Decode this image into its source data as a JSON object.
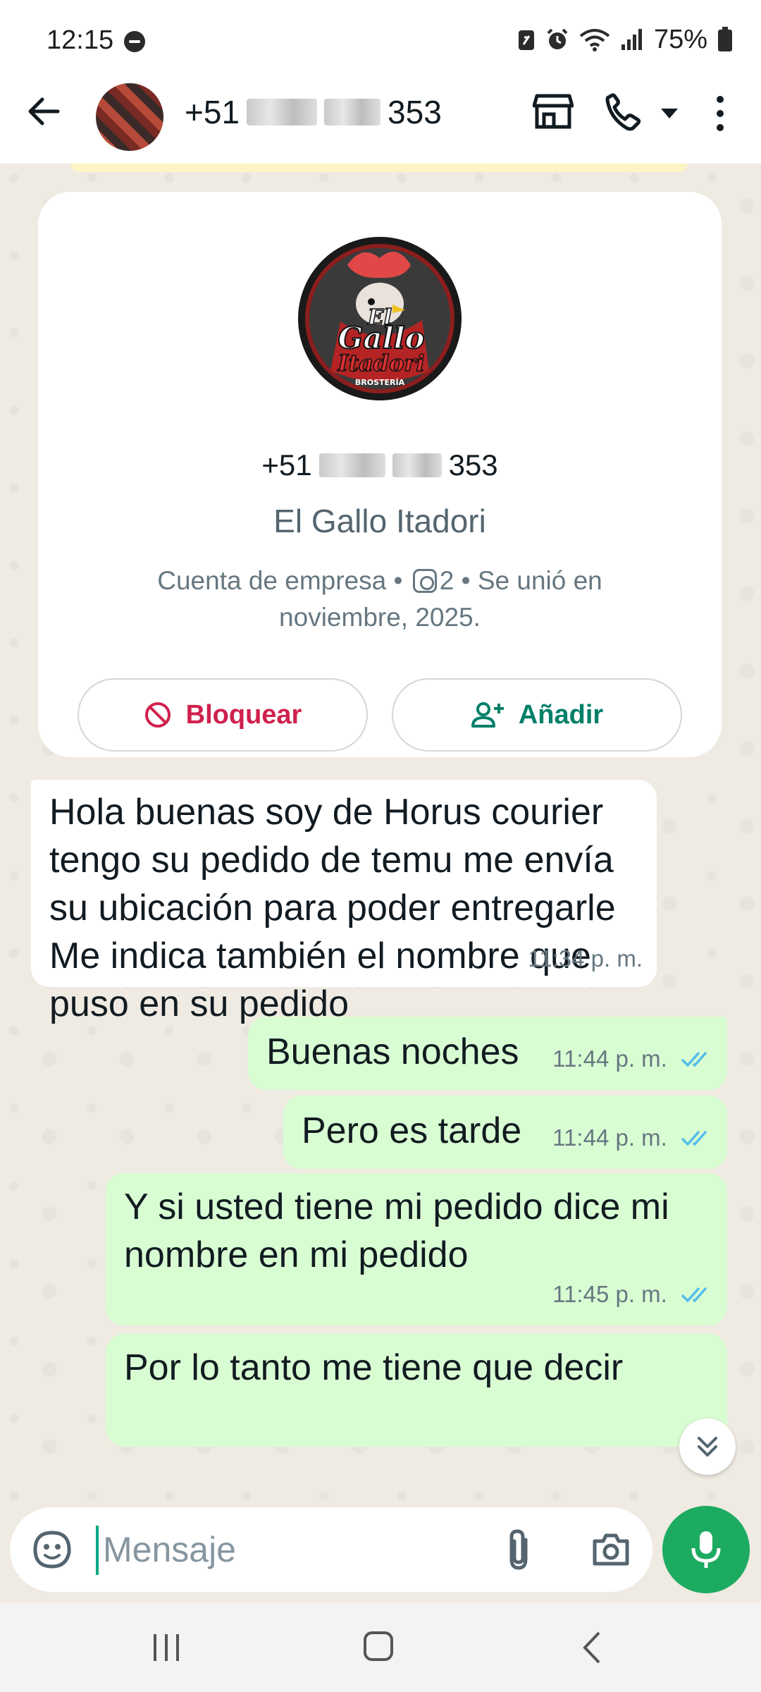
{
  "status_bar": {
    "time": "12:15",
    "battery_percent": "75%",
    "icons": [
      "do-not-disturb-icon",
      "battery-saver-icon",
      "alarm-icon",
      "wifi-icon",
      "signal-icon",
      "battery-icon"
    ]
  },
  "header": {
    "contact_prefix": "+51",
    "contact_suffix": "353",
    "icons": [
      "back-arrow-icon",
      "avatar",
      "store-icon",
      "phone-call-icon",
      "dropdown-caret-icon",
      "more-vert-icon"
    ]
  },
  "business_card": {
    "phone_prefix": "+51",
    "phone_suffix": "353",
    "name": "El Gallo Itadori",
    "meta_prefix": "Cuenta de empresa •",
    "instagram_count": "2",
    "meta_suffix": "• Se unió en noviembre, 2025.",
    "logo_text_top": "El",
    "logo_text_mid": "Gallo",
    "logo_text_bottom": "Itadori",
    "logo_tagline": "BROSTERÍA",
    "block_label": "Bloquear",
    "add_label": "Añadir"
  },
  "messages": [
    {
      "direction": "in",
      "text": "Hola buenas soy de Horus courier tengo su pedido de temu me envía su ubicación para poder entregarle\nMe indica también el nombre que puso en su pedido",
      "time": "11:34 p. m."
    },
    {
      "direction": "out",
      "text": "Buenas noches",
      "time": "11:44 p. m.",
      "read": true
    },
    {
      "direction": "out",
      "text": "Pero es tarde",
      "time": "11:44 p. m.",
      "read": true
    },
    {
      "direction": "out",
      "text": "Y si usted tiene mi pedido dice mi nombre en mi pedido",
      "time": "11:45 p. m.",
      "read": true
    },
    {
      "direction": "out",
      "text": "Por lo tanto me tiene que decir",
      "time": "",
      "read": false
    }
  ],
  "composer": {
    "placeholder": "Mensaje"
  },
  "colors": {
    "accent": "#1daa61",
    "outgoing_bubble": "#d9fdd3",
    "incoming_bubble": "#ffffff",
    "chat_background": "#efeae2",
    "block_red": "#d0214e",
    "add_green": "#008069",
    "read_ticks": "#53bdeb"
  }
}
